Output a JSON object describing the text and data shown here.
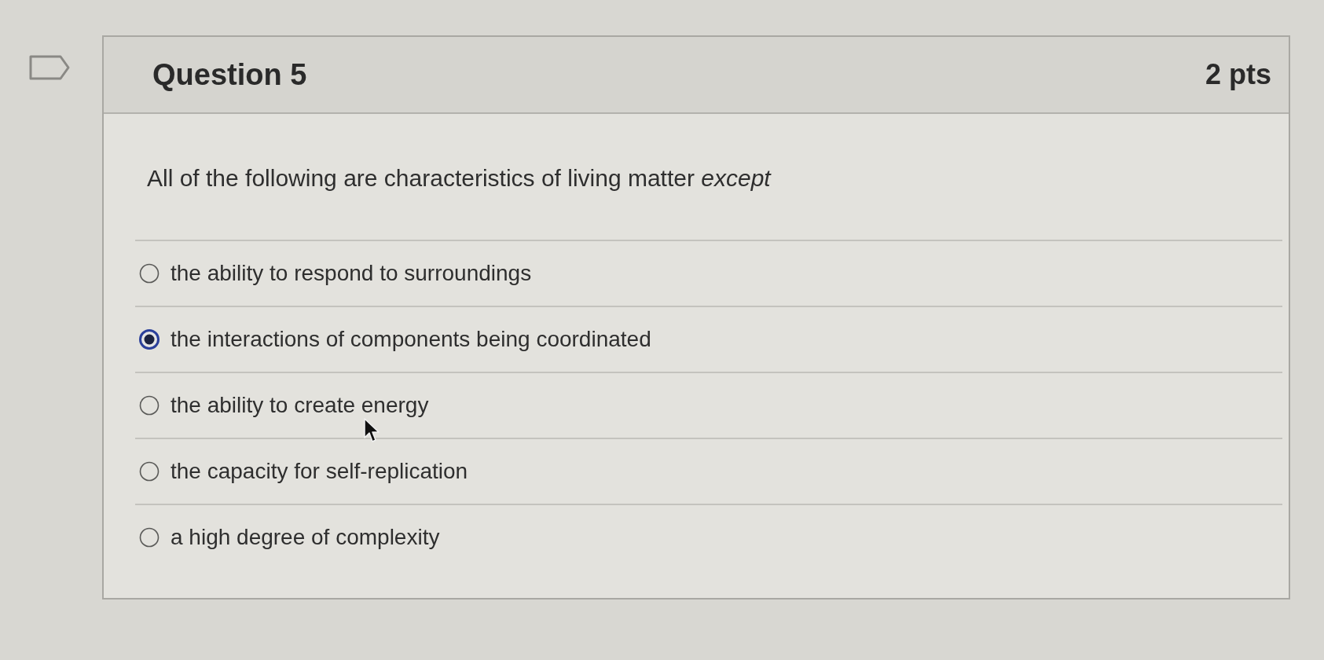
{
  "question": {
    "title": "Question 5",
    "points": "2 pts",
    "prompt": "All of the following are characteristics of living matter *except*"
  },
  "options": [
    {
      "label": "the ability to respond to surroundings",
      "selected": false
    },
    {
      "label": "the interactions of components being coordinated",
      "selected": true
    },
    {
      "label": "the ability to create energy",
      "selected": false
    },
    {
      "label": "the capacity for self-replication",
      "selected": false
    },
    {
      "label": "a high degree of complexity",
      "selected": false
    }
  ]
}
